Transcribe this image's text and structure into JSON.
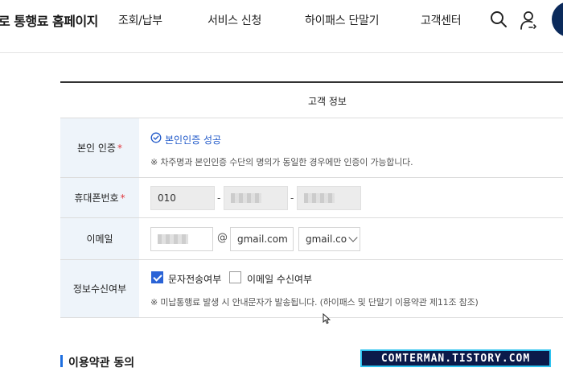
{
  "header": {
    "site_title": "로 통행료 홈페이지",
    "nav": [
      "조회/납부",
      "서비스 신청",
      "하이패스 단말기",
      "고객센터"
    ],
    "icons": [
      "search-icon",
      "user-icon"
    ],
    "brand_color": "#0b2a5b"
  },
  "form": {
    "section_title": "고객 정보",
    "verification": {
      "label": "본인 인증",
      "required_mark": "*",
      "status": "본인인증 성공",
      "note": "※ 차주명과 본인인증 수단의 명의가 동일한 경우에만 인증이 가능합니다."
    },
    "phone": {
      "label": "휴대폰번호",
      "required_mark": "*",
      "part1": "010",
      "separator": "-"
    },
    "email": {
      "label": "이메일",
      "at": "@",
      "domain_value": "gmail.com",
      "domain_select": "gmail.co"
    },
    "notification": {
      "label": "정보수신여부",
      "sms_label": "문자전송여부",
      "sms_checked": true,
      "email_label": "이메일 수신여부",
      "email_checked": false,
      "note": "※ 미납통행료 발생 시 안내문자가 발송됩니다. (하이패스 및 단말기 이용약관 제11조 참조)"
    }
  },
  "terms": {
    "title": "이용약관 동의"
  },
  "watermark": {
    "text": "COMTERMAN.TISTORY.COM"
  },
  "colors": {
    "accent": "#1e57c8",
    "checkbox": "#2a63d6",
    "required": "#e0383e",
    "label_bg": "#eef4fa"
  }
}
